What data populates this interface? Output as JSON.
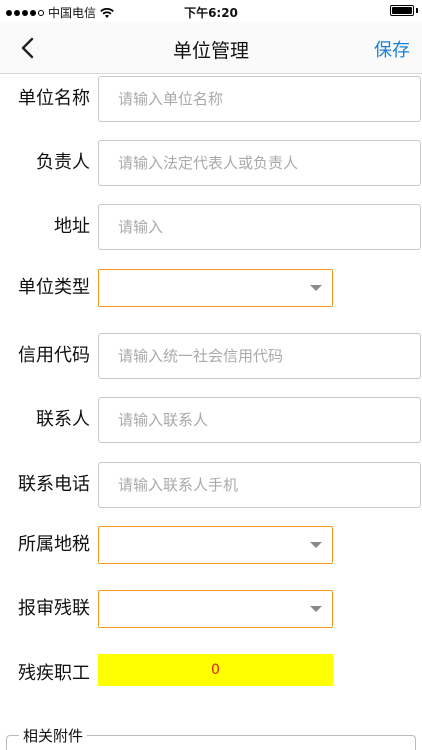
{
  "status_bar": {
    "carrier": "中国电信",
    "time": "下午6:20"
  },
  "nav": {
    "title": "单位管理",
    "save_label": "保存",
    "back_icon": "chevron-left-icon"
  },
  "form": {
    "unit_name": {
      "label": "单位名称",
      "placeholder": "请输入单位名称"
    },
    "responsible": {
      "label": "负责人",
      "placeholder": "请输入法定代表人或负责人"
    },
    "address": {
      "label": "地址",
      "placeholder": "请输入"
    },
    "unit_type": {
      "label": "单位类型",
      "value": ""
    },
    "credit_code": {
      "label": "信用代码",
      "placeholder": "请输入统一社会信用代码"
    },
    "contact": {
      "label": "联系人",
      "placeholder": "请输入联系人"
    },
    "phone": {
      "label": "联系电话",
      "placeholder": "请输入联系人手机"
    },
    "tax_office": {
      "label": "所属地税",
      "value": ""
    },
    "disability_fed": {
      "label": "报审残联",
      "value": ""
    },
    "disabled_staff": {
      "label": "残疾职工",
      "value": "0"
    }
  },
  "attachments": {
    "legend": "相关附件"
  },
  "colors": {
    "accent": "#1a7fd6",
    "select_border": "#f39a1e",
    "counter_bg": "#ffff00",
    "counter_text": "#e02020"
  }
}
